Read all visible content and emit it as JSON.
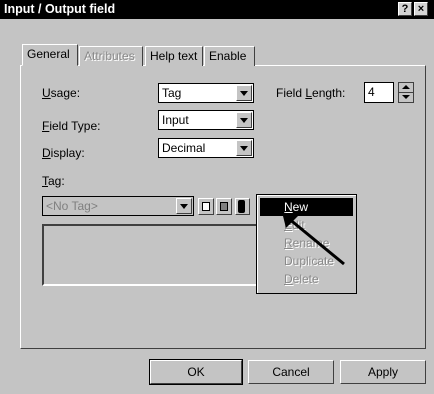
{
  "window": {
    "title": "Input / Output field",
    "help_glyph": "?",
    "close_glyph": "×"
  },
  "tabs": [
    {
      "label": "General",
      "active": true
    },
    {
      "label": "Attributes",
      "disabled": true
    },
    {
      "label": "Help text"
    },
    {
      "label": "Enable"
    }
  ],
  "form": {
    "usage": {
      "label_hot": "U",
      "label_rest": "sage:",
      "value": "Tag"
    },
    "field_type": {
      "label_hot": "F",
      "label_rest": "ield Type:",
      "value": "Input"
    },
    "display": {
      "label_hot": "D",
      "label_rest": "isplay:",
      "value": "Decimal"
    },
    "field_length": {
      "label_pre": "Field ",
      "label_hot": "L",
      "label_rest": "ength:",
      "value": "4"
    },
    "tag": {
      "label_hot": "T",
      "label_rest": "ag:",
      "value": "<No Tag>"
    }
  },
  "context_menu": {
    "items": [
      {
        "hot": "N",
        "rest": "ew",
        "state": "selected"
      },
      {
        "hot": "E",
        "rest": "dit",
        "state": "disabled"
      },
      {
        "hot": "R",
        "rest": "ename",
        "state": "disabled"
      },
      {
        "hot": "",
        "rest": "Duplicate",
        "state": "disabled"
      },
      {
        "hot": "D",
        "rest": "elete",
        "state": "disabled"
      }
    ]
  },
  "buttons": {
    "ok": "OK",
    "cancel": "Cancel",
    "apply": "Apply"
  },
  "icons": [
    "question-icon",
    "close-icon",
    "dropdown-arrow-icon",
    "spin-up-icon",
    "spin-down-icon",
    "tag-properties-icon",
    "tag-list-icon",
    "tag-menu-icon",
    "mouse-pointer-arrow-icon"
  ],
  "colors": {
    "face": "#c4c4c4",
    "titlebar": "#000000",
    "selection": "#000000",
    "disabled_text": "#8a8a8a"
  }
}
